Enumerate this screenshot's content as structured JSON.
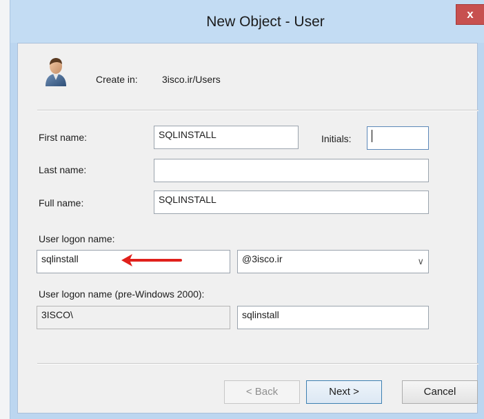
{
  "window": {
    "title": "New Object - User",
    "close_glyph": "x"
  },
  "header": {
    "icon": "user-icon",
    "create_in_label": "Create in:",
    "create_in_value": "3isco.ir/Users"
  },
  "form": {
    "first_name_label": "First name:",
    "first_name_value": "SQLINSTALL",
    "initials_label": "Initials:",
    "initials_value": "",
    "last_name_label": "Last name:",
    "last_name_value": "",
    "full_name_label": "Full name:",
    "full_name_value": "SQLINSTALL",
    "logon_name_label": "User logon name:",
    "logon_name_value": "sqlinstall",
    "domain_suffix": "@3isco.ir",
    "pre2000_label": "User logon name (pre-Windows 2000):",
    "pre2000_domain": "3ISCO\\",
    "pre2000_value": "sqlinstall"
  },
  "buttons": {
    "back": "< Back",
    "next": "Next >",
    "cancel": "Cancel"
  },
  "colors": {
    "annotation_arrow": "#e0201b",
    "close_button": "#c7504f",
    "titlebar": "#c3dcf3"
  }
}
